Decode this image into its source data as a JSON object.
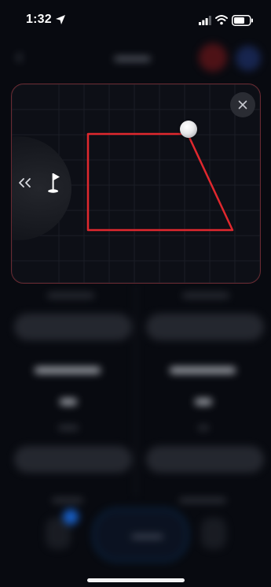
{
  "status_bar": {
    "time": "1:32",
    "icons": [
      "location-arrow-icon",
      "signal-icon",
      "wifi-icon",
      "battery-icon"
    ]
  },
  "overlay": {
    "close_icon": "close-icon",
    "drawer_icons": [
      "chevron-double-left-icon",
      "golf-flag-icon"
    ],
    "shape_color": "#e0282e",
    "border_color": "#6a2a32"
  },
  "colors": {
    "background": "#080a10",
    "card": "#0d0f16",
    "accent_red": "#e0282e",
    "accent_blue": "#1a6adf"
  }
}
